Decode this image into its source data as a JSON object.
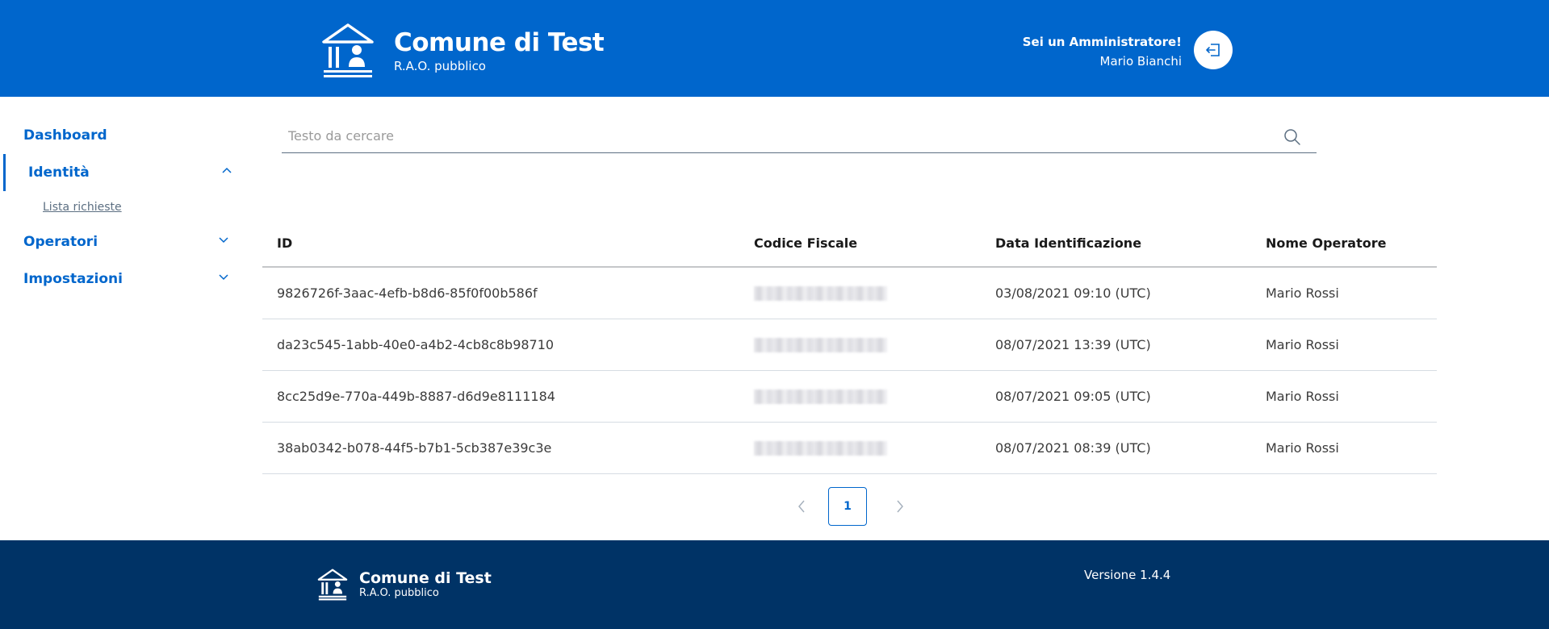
{
  "header": {
    "title": "Comune di Test",
    "subtitle": "R.A.O. pubblico",
    "role": "Sei un Amministratore!",
    "user_name": "Mario Bianchi",
    "logout_icon": "logout-icon"
  },
  "sidebar": {
    "items": [
      {
        "label": "Dashboard"
      },
      {
        "label": "Identità",
        "expanded": true,
        "sub": [
          {
            "label": "Lista richieste"
          }
        ]
      },
      {
        "label": "Operatori",
        "expanded": false
      },
      {
        "label": "Impostazioni",
        "expanded": false
      }
    ]
  },
  "search": {
    "placeholder": "Testo da cercare",
    "icon": "search-icon"
  },
  "table": {
    "columns": [
      "ID",
      "Codice Fiscale",
      "Data Identificazione",
      "Nome Operatore"
    ],
    "rows": [
      {
        "id": "9826726f-3aac-4efb-b8d6-85f0f00b586f",
        "codice_fiscale_blurred": true,
        "data": "03/08/2021 09:10 (UTC)",
        "operatore": "Mario Rossi"
      },
      {
        "id": "da23c545-1abb-40e0-a4b2-4cb8c8b98710",
        "codice_fiscale_blurred": true,
        "data": "08/07/2021 13:39 (UTC)",
        "operatore": "Mario Rossi"
      },
      {
        "id": "8cc25d9e-770a-449b-8887-d6d9e8111184",
        "codice_fiscale_blurred": true,
        "data": "08/07/2021 09:05 (UTC)",
        "operatore": "Mario Rossi"
      },
      {
        "id": "38ab0342-b078-44f5-b7b1-5cb387e39c3e",
        "codice_fiscale_blurred": true,
        "data": "08/07/2021 08:39 (UTC)",
        "operatore": "Mario Rossi"
      }
    ]
  },
  "pagination": {
    "current": "1"
  },
  "footer": {
    "title": "Comune di Test",
    "subtitle": "R.A.O. pubblico",
    "version": "Versione 1.4.4"
  },
  "colors": {
    "primary": "#0066cc",
    "footer_bg": "#003366",
    "text": "#1a1a1a",
    "muted": "#5c6f82"
  }
}
